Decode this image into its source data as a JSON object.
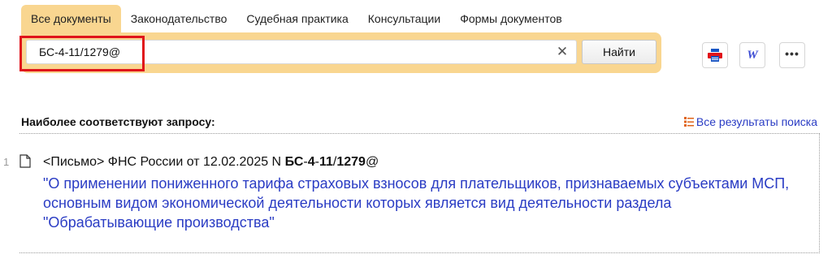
{
  "tabs": [
    {
      "label": "Все документы",
      "active": true
    },
    {
      "label": "Законодательство",
      "active": false
    },
    {
      "label": "Судебная практика",
      "active": false
    },
    {
      "label": "Консультации",
      "active": false
    },
    {
      "label": "Формы документов",
      "active": false
    }
  ],
  "search": {
    "value": "БС-4-11/1279@",
    "clear_icon": "close-icon",
    "find_label": "Найти"
  },
  "toolbar": {
    "print_icon": "printer-icon",
    "word_icon": "word-export-icon",
    "more_label": "•••"
  },
  "results": {
    "heading": "Наиболее соответствуют запросу:",
    "all_results_label": "Все результаты поиска",
    "items": [
      {
        "number": "1",
        "meta_prefix": "<Письмо> ФНС России от 12.02.2025 N ",
        "meta_doc_parts": [
          "БС",
          "-",
          "4",
          "-",
          "11",
          "/",
          "1279",
          "@"
        ],
        "title": "\"О применении пониженного тарифа страховых взносов для плательщиков, признаваемых субъектами МСП, основным видом экономической деятельности которых является вид деятельности раздела \"Обрабатывающие производства\""
      }
    ]
  },
  "colors": {
    "accent_panel": "#f9d690",
    "link": "#2a3cc4",
    "highlight": "#e0131a",
    "print_icon": "#1a56c4"
  }
}
